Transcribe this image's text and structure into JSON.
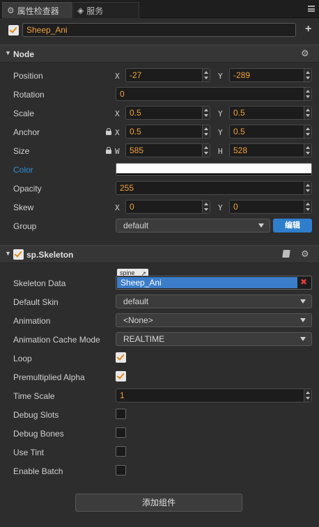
{
  "tabs": [
    {
      "label": "属性检查器",
      "icon": "gear-icon"
    },
    {
      "label": "服务",
      "icon": "service-icon"
    }
  ],
  "node_name": "Sheep_Ani",
  "node_section": {
    "title": "Node",
    "position": {
      "label": "Position",
      "x_axis": "X",
      "x": "-27",
      "y_axis": "Y",
      "y": "-289"
    },
    "rotation": {
      "label": "Rotation",
      "value": "0"
    },
    "scale": {
      "label": "Scale",
      "x_axis": "X",
      "x": "0.5",
      "y_axis": "Y",
      "y": "0.5"
    },
    "anchor": {
      "label": "Anchor",
      "x_axis": "X",
      "x": "0.5",
      "y_axis": "Y",
      "y": "0.5"
    },
    "size": {
      "label": "Size",
      "w_axis": "W",
      "w": "585",
      "h_axis": "H",
      "h": "528"
    },
    "color": {
      "label": "Color",
      "value": "#ffffff"
    },
    "opacity": {
      "label": "Opacity",
      "value": "255"
    },
    "skew": {
      "label": "Skew",
      "x_axis": "X",
      "x": "0",
      "y_axis": "Y",
      "y": "0"
    },
    "group": {
      "label": "Group",
      "value": "default",
      "edit_label": "编辑"
    }
  },
  "skeleton_section": {
    "title": "sp.Skeleton",
    "skeleton_data": {
      "label": "Skeleton Data",
      "tag": "spine",
      "value": "Sheep_Ani"
    },
    "default_skin": {
      "label": "Default Skin",
      "value": "default"
    },
    "animation": {
      "label": "Animation",
      "value": "<None>"
    },
    "animation_cache_mode": {
      "label": "Animation Cache Mode",
      "value": "REALTIME"
    },
    "loop": {
      "label": "Loop",
      "checked": true
    },
    "premultiplied_alpha": {
      "label": "Premultiplied Alpha",
      "checked": true
    },
    "time_scale": {
      "label": "Time Scale",
      "value": "1"
    },
    "debug_slots": {
      "label": "Debug Slots",
      "checked": false
    },
    "debug_bones": {
      "label": "Debug Bones",
      "checked": false
    },
    "use_tint": {
      "label": "Use Tint",
      "checked": false
    },
    "enable_batch": {
      "label": "Enable Batch",
      "checked": false
    }
  },
  "add_component_label": "添加组件",
  "colors": {
    "accent": "#f0a23c",
    "highlight": "#3b7dc9",
    "label_blue": "#2f8fd6"
  }
}
